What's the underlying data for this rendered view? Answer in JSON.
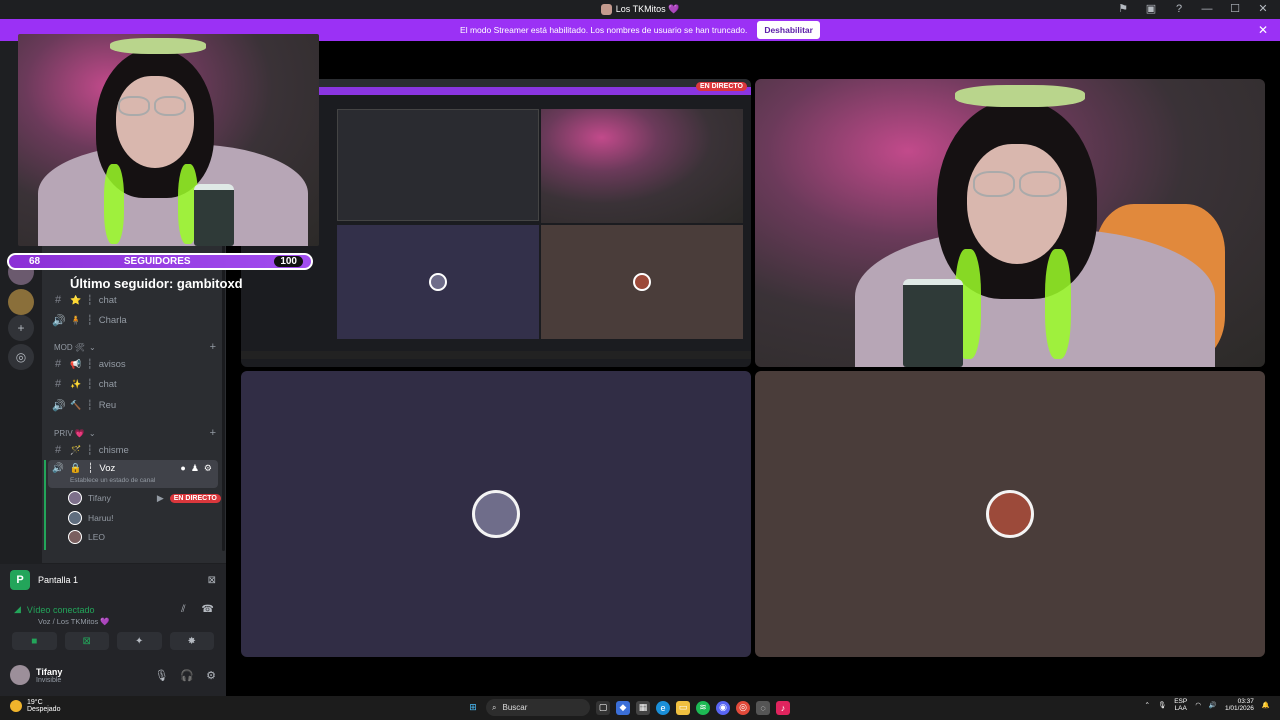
{
  "window": {
    "title": "Los TKMitos 💜"
  },
  "banner": {
    "text": "El modo Streamer está habilitado. Los nombres de usuario se han truncado.",
    "button": "Deshabilitar"
  },
  "channels": {
    "top": [
      {
        "icon": "⭐",
        "name": "chat",
        "type": "text"
      },
      {
        "icon": "🧍",
        "name": "Charla",
        "type": "voice"
      }
    ],
    "categories": [
      {
        "label": "MOD 🛠",
        "items": [
          {
            "icon": "📢",
            "name": "avisos",
            "type": "text"
          },
          {
            "icon": "✨",
            "name": "chat",
            "type": "text"
          },
          {
            "icon": "🔨",
            "name": "Reu",
            "type": "voice"
          }
        ]
      },
      {
        "label": "PRIV 💗",
        "items": [
          {
            "icon": "🪄",
            "name": "chisme",
            "type": "text"
          }
        ]
      }
    ],
    "active_voice": {
      "name": "Voz",
      "status_hint": "Establece un estado de canal",
      "users": [
        {
          "name": "Tifany",
          "live": true
        },
        {
          "name": "Haruu!",
          "live": false
        },
        {
          "name": "LEO",
          "live": false
        }
      ],
      "live_label": "EN DIRECTO"
    }
  },
  "bottom": {
    "screen_label": "Pantalla 1",
    "video_status": "Vídeo conectado",
    "video_sub": "Voz / Los TKMitos 💜",
    "user_name": "Tifany",
    "user_status": "Invisible"
  },
  "overlay": {
    "followers_current": "68",
    "followers_label": "SEGUIDORES",
    "followers_goal": "100",
    "followers_progress": 0.68,
    "last_follower": "Último seguidor: gambitoxd"
  },
  "stage": {
    "live_badge": "EN DIRECTO"
  },
  "taskbar": {
    "weather_temp": "19°C",
    "weather_desc": "Despejado",
    "search_placeholder": "Buscar",
    "lang_top": "ESP",
    "lang_bottom": "LAA",
    "time": "03:37",
    "date": "1/01/2026"
  },
  "colors": {
    "accent_purple": "#9b31f5",
    "connected_green": "#23a55a",
    "live_red": "#da373c"
  }
}
